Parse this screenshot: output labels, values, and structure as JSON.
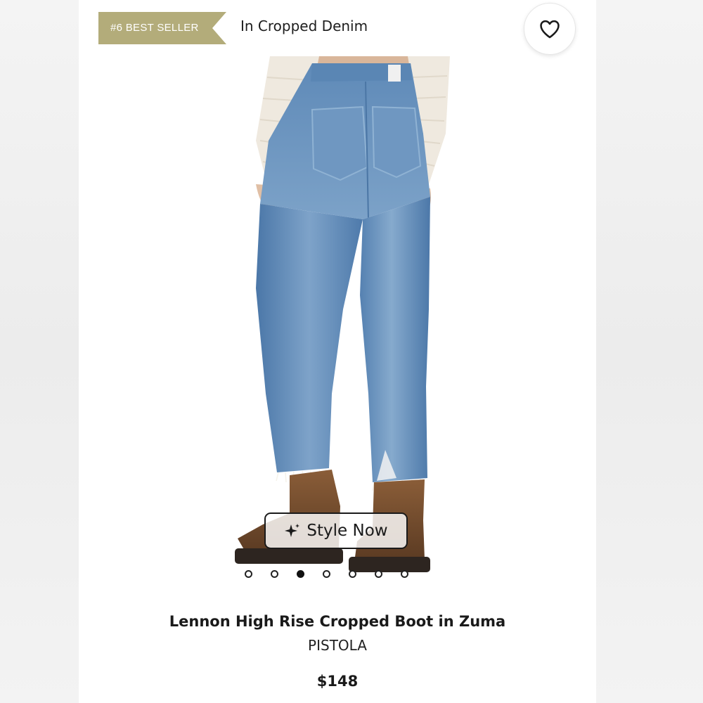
{
  "header": {
    "badge_label": "#6 BEST SELLER",
    "category_label": "In Cropped Denim",
    "favorite_icon": "heart-icon"
  },
  "gallery": {
    "style_now_label": "Style Now",
    "style_now_icon": "sparkle-icon",
    "total_images": 7,
    "active_index": 2
  },
  "product": {
    "name": "Lennon High Rise Cropped Boot in Zuma",
    "brand": "PISTOLA",
    "price": "$148"
  },
  "colors": {
    "badge": "#b3ac7a",
    "denim": "#5c87b5",
    "sweater": "#efe9df",
    "boot": "#6e4a2e"
  }
}
